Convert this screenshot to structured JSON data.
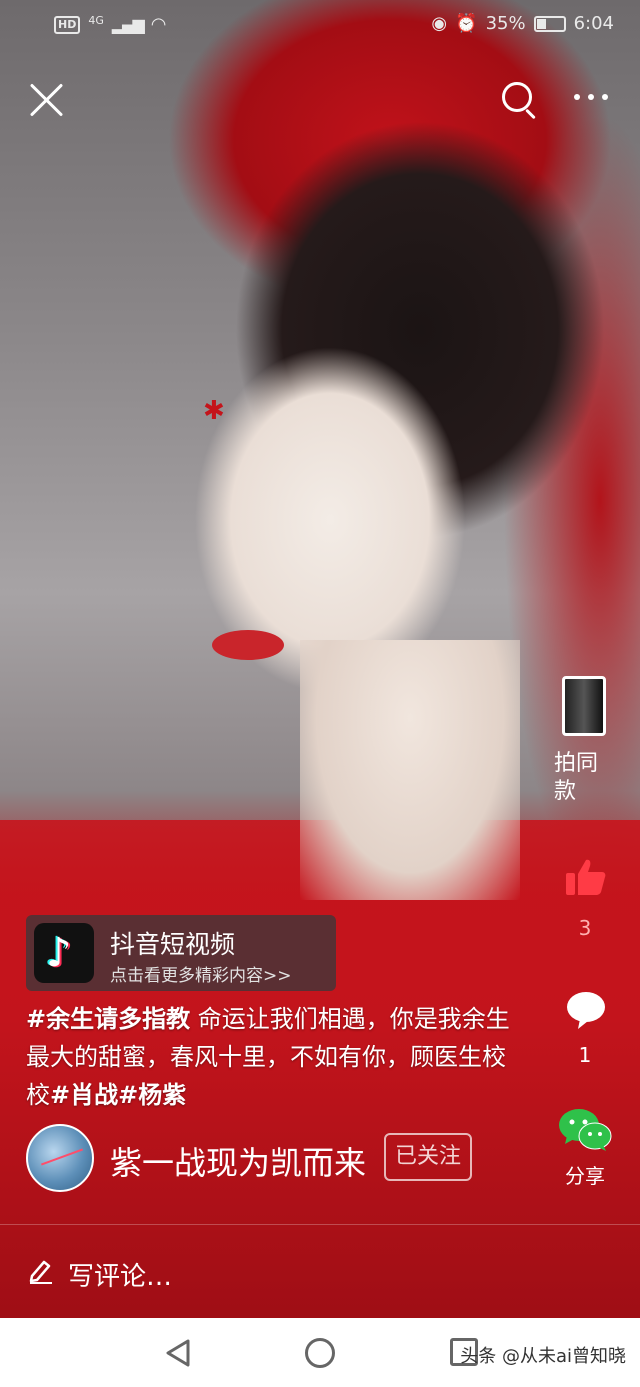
{
  "status_bar": {
    "hd": "HD",
    "network": "4G",
    "battery_percent": "35%",
    "battery_level": 0.35,
    "time": "6:04"
  },
  "top_bar": {
    "close_icon": "close-icon",
    "search_icon": "search-icon",
    "more_icon": "more-icon"
  },
  "rail": {
    "same_label": "拍同款",
    "like_count": "3",
    "comment_count": "1",
    "share_label": "分享",
    "like_color": "#ff3b45",
    "wechat_color": "#2fc14a"
  },
  "app_card": {
    "name": "抖音短视频",
    "subtitle": "点击看更多精彩内容>>"
  },
  "caption": {
    "tag1": "#余生请多指教",
    "text": " 命运让我们相遇，你是我余生最大的甜蜜，春风十里，不如有你，顾医生校校",
    "tag2": "#肖战",
    "tag3": "#杨紫"
  },
  "author": {
    "name": "紫一战现为凯而来",
    "follow_label": "已关注"
  },
  "comment_bar": {
    "placeholder": "写评论…"
  },
  "watermark": "头条 @从未ai曾知晓"
}
